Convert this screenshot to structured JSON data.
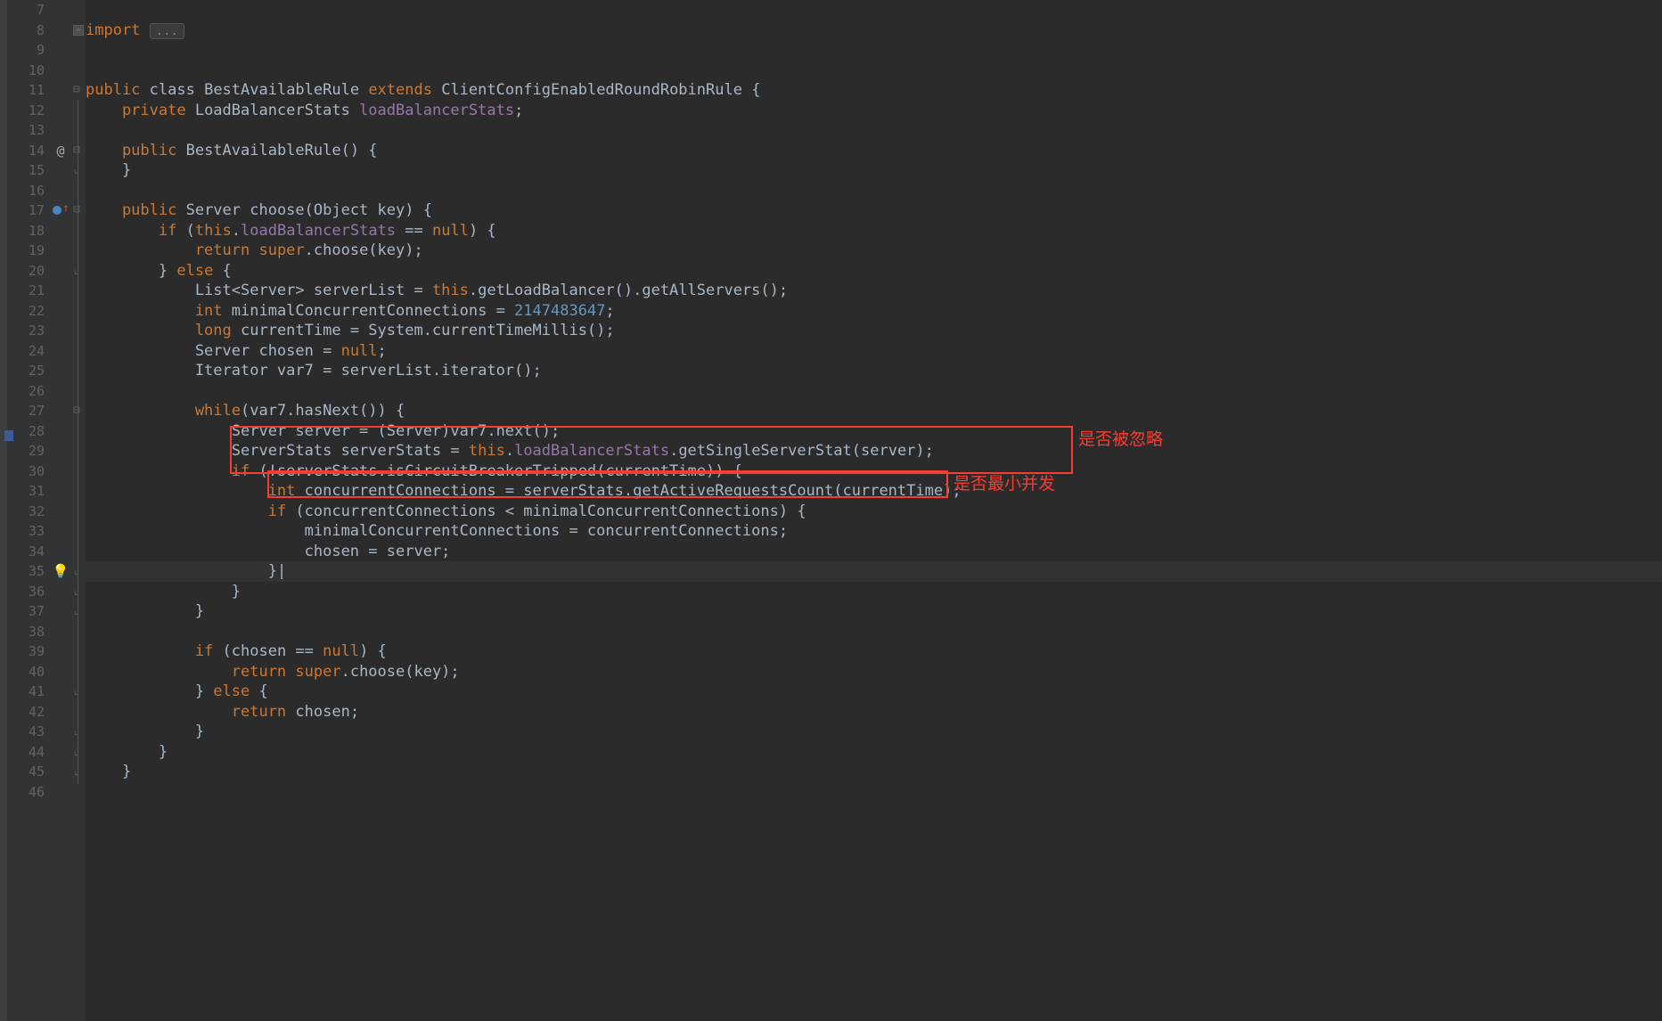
{
  "gutter": {
    "start": 7,
    "end": 46
  },
  "icons": {
    "override": "@",
    "bulb": "💡"
  },
  "annotations": {
    "ignore": "是否被忽略",
    "minconc": "是否最小并发"
  },
  "code": {
    "l8_import": "import",
    "l8_dots": "...",
    "l11a": "public",
    "l11b": " class ",
    "l11c": "BestAvailableRule ",
    "l11d": "extends",
    "l11e": " ClientConfigEnabledRoundRobinRule {",
    "l12a": "    private",
    "l12b": " LoadBalancerStats ",
    "l12c": "loadBalancerStats",
    "l12d": ";",
    "l14a": "    public",
    "l14b": " BestAvailableRule() {",
    "l15": "    }",
    "l17a": "    public",
    "l17b": " Server choose(Object key) {",
    "l18a": "        if",
    "l18b": " (",
    "l18c": "this",
    "l18d": ".",
    "l18e": "loadBalancerStats",
    "l18f": " == ",
    "l18g": "null",
    "l18h": ") {",
    "l19a": "            return ",
    "l19b": "super",
    "l19c": ".choose(key);",
    "l20a": "        } ",
    "l20b": "else",
    "l20c": " {",
    "l21a": "            List<Server> serverList = ",
    "l21b": "this",
    "l21c": ".getLoadBalancer().getAllServers();",
    "l22a": "            int",
    "l22b": " minimalConcurrentConnections = ",
    "l22c": "2147483647",
    "l22d": ";",
    "l23a": "            long",
    "l23b": " currentTime = System.currentTimeMillis();",
    "l24a": "            Server chosen = ",
    "l24b": "null",
    "l24c": ";",
    "l25": "            Iterator var7 = serverList.iterator();",
    "l27a": "            while",
    "l27b": "(var7.hasNext()) {",
    "l28": "                Server server = (Server)var7.next();",
    "l29a": "                ServerStats serverStats = ",
    "l29b": "this",
    "l29c": ".",
    "l29d": "loadBalancerStats",
    "l29e": ".getSingleServerStat(server);",
    "l30a": "                if",
    "l30b": " (!serverStats.isCircuitBreakerTripped(currentTime)) {",
    "l31a": "                    int",
    "l31b": " concurrentConnections = serverStats.getActiveRequestsCount(currentTime);",
    "l32a": "                    if",
    "l32b": " (concurrentConnections < minimalConcurrentConnections) {",
    "l33": "                        minimalConcurrentConnections = concurrentConnections;",
    "l34": "                        chosen = server;",
    "l35": "                    }",
    "l36": "                }",
    "l37": "            }",
    "l39a": "            if",
    "l39b": " (chosen == ",
    "l39c": "null",
    "l39d": ") {",
    "l40a": "                return ",
    "l40b": "super",
    "l40c": ".choose(key);",
    "l41a": "            } ",
    "l41b": "else",
    "l41c": " {",
    "l42a": "                return",
    "l42b": " chosen;",
    "l43": "            }",
    "l44": "        }",
    "l45": "    }"
  }
}
